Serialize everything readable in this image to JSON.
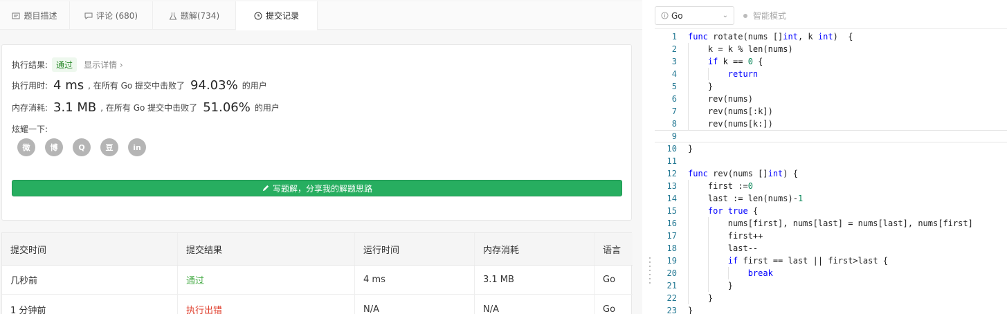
{
  "tabs": [
    {
      "label": "题目描述",
      "icon": "description-icon"
    },
    {
      "label": "评论 (680)",
      "icon": "comment-icon"
    },
    {
      "label": "题解(734)",
      "icon": "flask-icon"
    },
    {
      "label": "提交记录",
      "icon": "clock-icon"
    }
  ],
  "result": {
    "label": "执行结果:",
    "status": "通过",
    "detail_link": "显示详情 ›",
    "time_label": "执行用时:",
    "time_value": "4 ms",
    "time_mid": ", 在所有 Go 提交中击败了",
    "time_pct": "94.03%",
    "time_suffix": "的用户",
    "mem_label": "内存消耗:",
    "mem_value": "3.1 MB",
    "mem_mid": ", 在所有 Go 提交中击败了",
    "mem_pct": "51.06%",
    "mem_suffix": "的用户",
    "share_label": "炫耀一下:",
    "share_icons": [
      "wechat-icon",
      "weibo-icon",
      "qq-icon",
      "douban-icon",
      "linkedin-icon"
    ],
    "share_glyphs": [
      "微",
      "博",
      "Q",
      "豆",
      "in"
    ],
    "write_button": "写题解，分享我的解题思路"
  },
  "table": {
    "headers": [
      "提交时间",
      "提交结果",
      "运行时间",
      "内存消耗",
      "语言"
    ],
    "rows": [
      [
        "几秒前",
        "通过",
        "4 ms",
        "3.1 MB",
        "Go"
      ],
      [
        "1 分钟前",
        "执行出错",
        "N/A",
        "N/A",
        "Go"
      ]
    ]
  },
  "editor": {
    "language": "Go",
    "smart_mode": "智能模式",
    "lines": [
      "func rotate(nums []int, k int)  {",
      "    k = k % len(nums)",
      "    if k == 0 {",
      "        return",
      "    }",
      "    rev(nums)",
      "    rev(nums[:k])",
      "    rev(nums[k:])",
      "",
      "}",
      "",
      "func rev(nums []int) {",
      "    first :=0",
      "    last := len(nums)-1",
      "    for true {",
      "        nums[first], nums[last] = nums[last], nums[first]",
      "        first++",
      "        last--",
      "        if first == last || first>last {",
      "            break",
      "        }",
      "    }",
      "}"
    ]
  },
  "colors": {
    "accent_green": "#27ae60",
    "error_red": "#e0412f",
    "keyword_blue": "#0000ff"
  }
}
